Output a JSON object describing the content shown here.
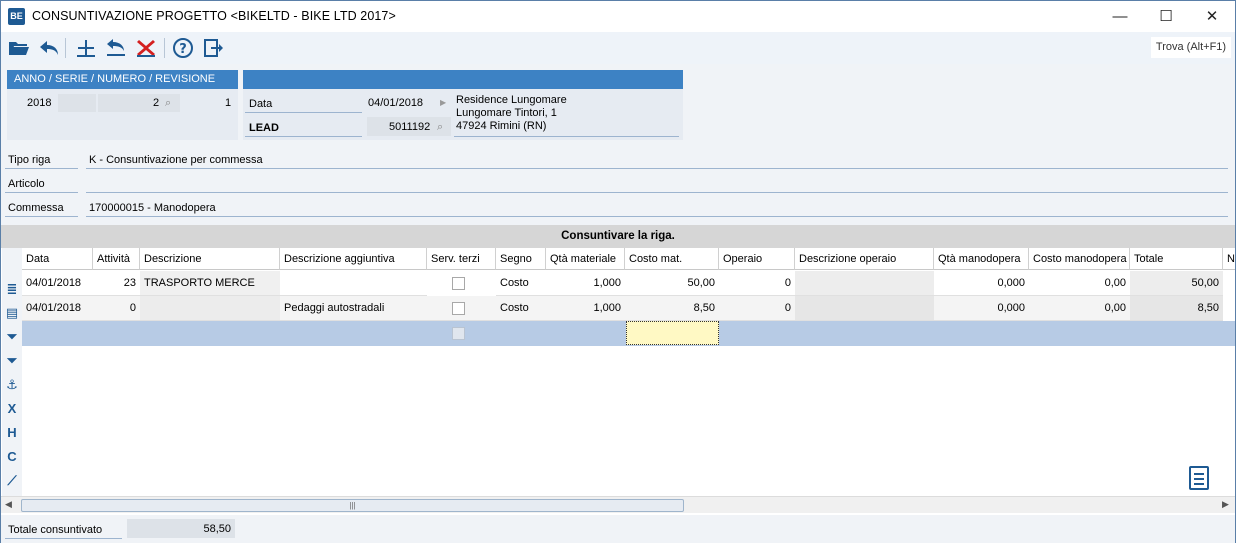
{
  "window": {
    "app_icon": "BE",
    "title": "CONSUNTIVAZIONE PROGETTO <BIKELTD - BIKE LTD 2017>",
    "minimize": "—",
    "maximize": "☐",
    "close": "✕"
  },
  "toolbar": {
    "icons": [
      "open-folder-icon",
      "undo-icon",
      "add-row-icon",
      "revert-icon",
      "delete-icon",
      "help-icon",
      "exit-icon"
    ],
    "find_label": "Trova (Alt+F1)"
  },
  "header": {
    "doc_box_title": "ANNO / SERIE / NUMERO / REVISIONE",
    "anno": "2018",
    "serie": "",
    "numero": "2",
    "revisione": "1",
    "data_label": "Data",
    "data_value": "04/01/2018",
    "lead_label": "LEAD",
    "lead_code": "5011192",
    "address_line1": "Residence Lungomare",
    "address_line2": "Lungomare Tintori, 1",
    "address_line3": "47924 Rimini (RN)"
  },
  "fields": {
    "tipo_riga_label": "Tipo riga",
    "tipo_riga_value": "K - Consuntivazione per commessa",
    "articolo_label": "Articolo",
    "articolo_value": "",
    "commessa_label": "Commessa",
    "commessa_value": "170000015 - Manodopera"
  },
  "grid": {
    "title": "Consuntivare la riga.",
    "columns": [
      "Data",
      "Attività",
      "Descrizione",
      "Descrizione aggiuntiva",
      "Serv. terzi",
      "Segno",
      "Qtà materiale",
      "Costo mat.",
      "Operaio",
      "Descrizione operaio",
      "Qtà manodopera",
      "Costo manodopera",
      "Totale",
      "N"
    ],
    "rows": [
      {
        "data": "04/01/2018",
        "attivita": "23",
        "descrizione": "TRASPORTO MERCE",
        "descr_agg": "",
        "serv_terzi": false,
        "segno": "Costo",
        "qta_mat": "1,000",
        "costo_mat": "50,00",
        "operaio": "0",
        "descr_operaio": "",
        "qta_mano": "0,000",
        "costo_mano": "0,00",
        "totale": "50,00"
      },
      {
        "data": "04/01/2018",
        "attivita": "0",
        "descrizione": "",
        "descr_agg": "Pedaggi autostradali",
        "serv_terzi": false,
        "segno": "Costo",
        "qta_mat": "1,000",
        "costo_mat": "8,50",
        "operaio": "0",
        "descr_operaio": "",
        "qta_mano": "0,000",
        "costo_mano": "0,00",
        "totale": "8,50"
      }
    ],
    "side_icons": [
      "list-icon",
      "grid-icon",
      "filter-add-icon",
      "filter-icon",
      "anchor-icon",
      "x-icon",
      "h-icon",
      "c-icon",
      "chart-icon"
    ]
  },
  "footer": {
    "totale_label": "Totale consuntivato",
    "totale_value": "58,50"
  }
}
